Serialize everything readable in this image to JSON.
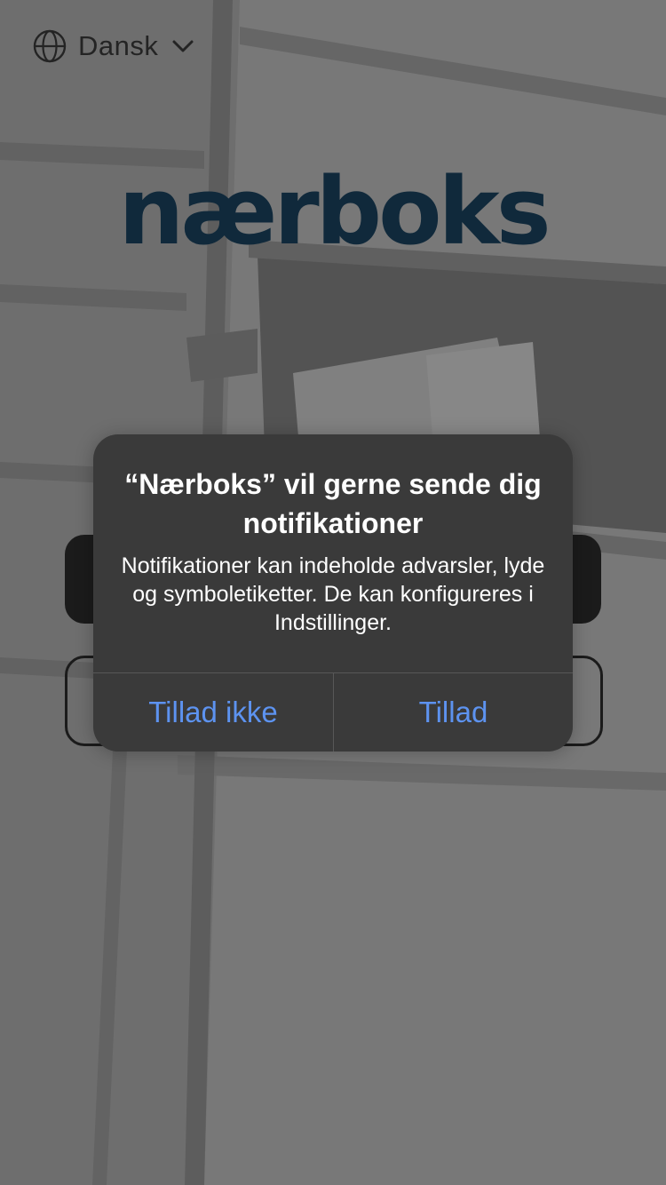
{
  "language_selector": {
    "icon": "globe-icon",
    "label": "Dansk",
    "chevron_icon": "chevron-down-icon"
  },
  "logo": {
    "text": "nærboks",
    "color": "#1b4563"
  },
  "alert": {
    "title": "“Nærboks” vil gerne sende dig notifikationer",
    "message": "Notifikationer kan indeholde advarsler, lyde og symboletiketter. De kan konfigureres i Indstillinger.",
    "buttons": {
      "deny_label": "Tillad ikke",
      "allow_label": "Tillad"
    },
    "button_color": "#5d93f0",
    "background_color": "#3a3a3a"
  }
}
